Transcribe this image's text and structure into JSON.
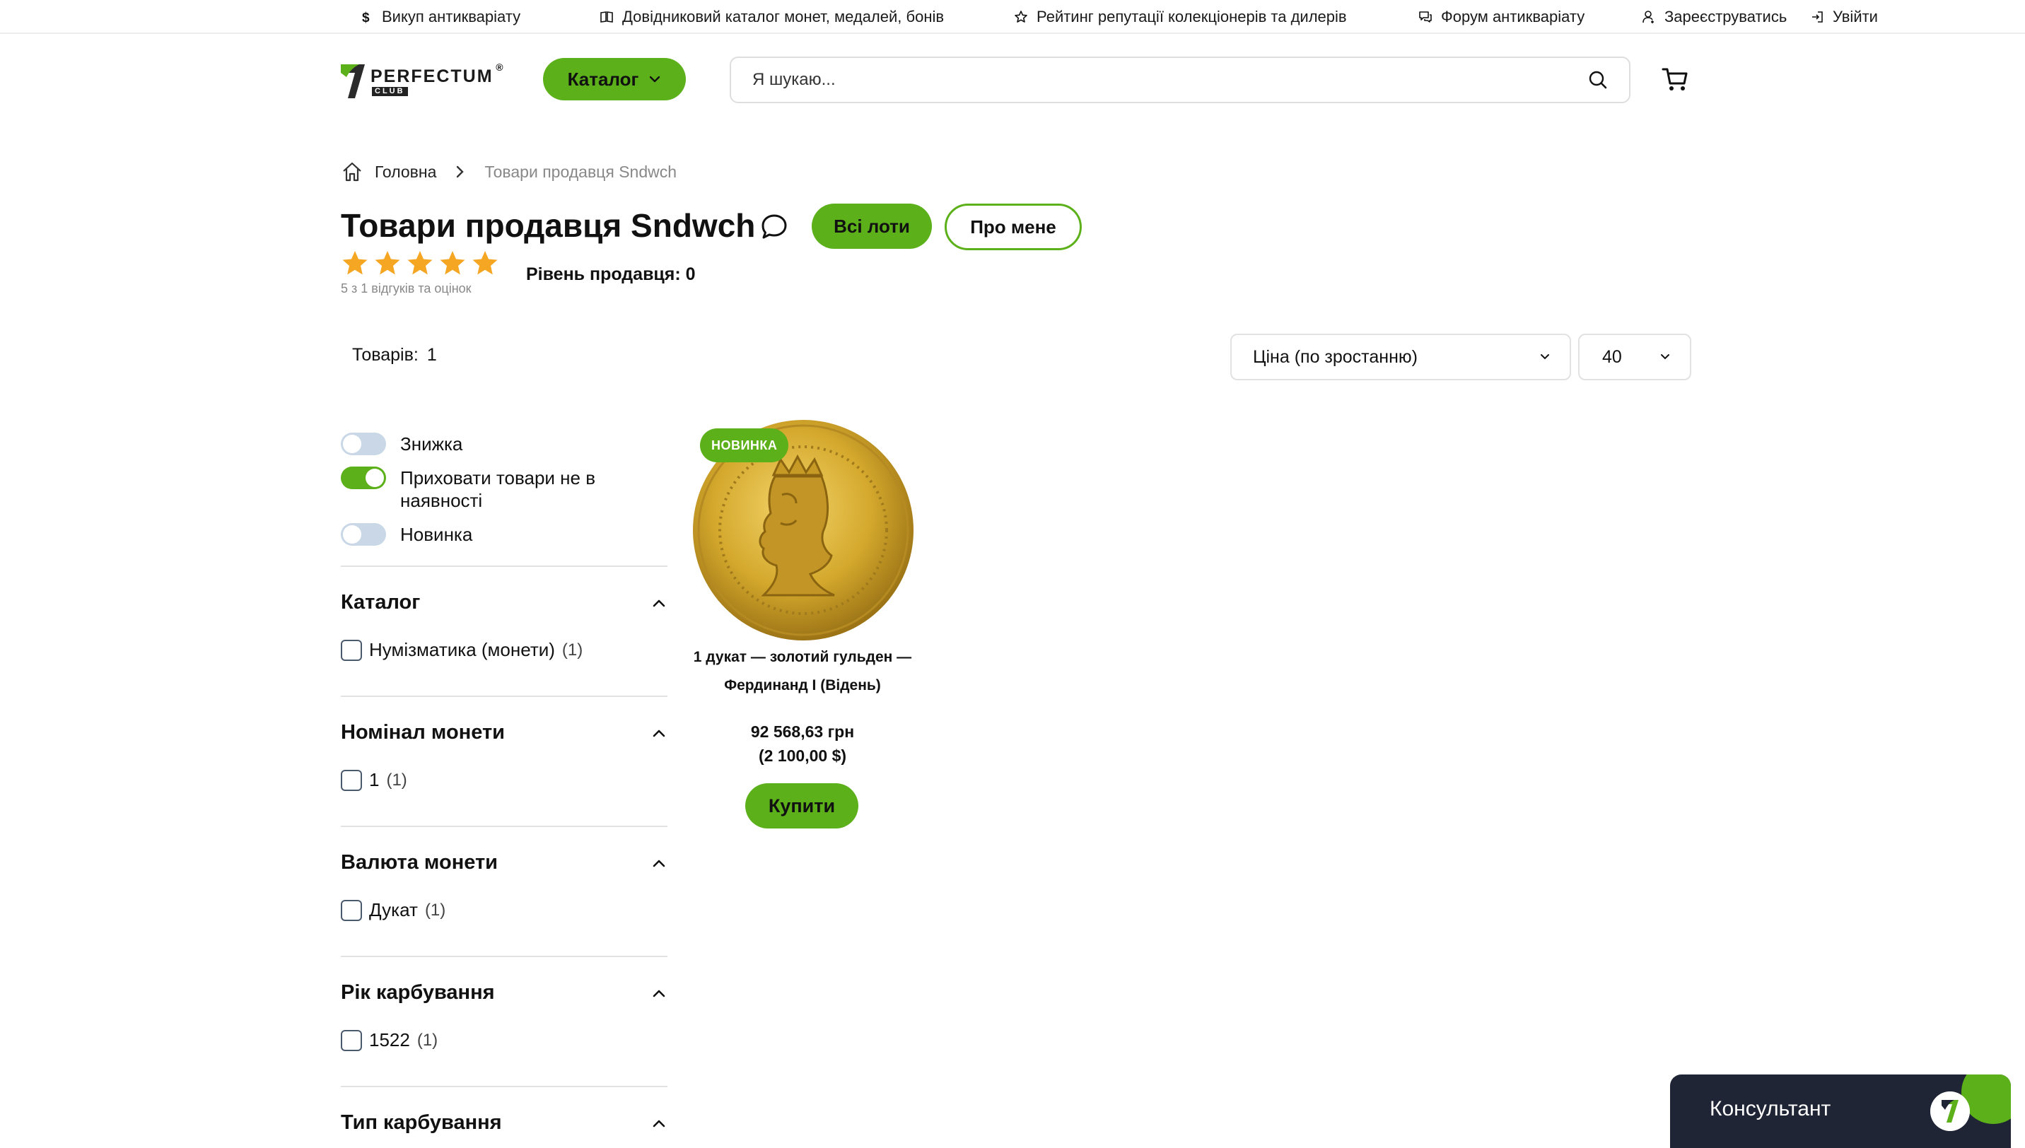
{
  "topbar": {
    "links": [
      {
        "label": "Викуп антикваріату",
        "icon": "dollar-icon"
      },
      {
        "label": "Довідниковий каталог монет, медалей, бонів",
        "icon": "book-icon"
      },
      {
        "label": "Рейтинг репутації колекціонерів та дилерів",
        "icon": "star-outline-icon"
      },
      {
        "label": "Форум антикваріату",
        "icon": "forum-icon"
      },
      {
        "label": "Зареєструватись",
        "icon": "register-icon"
      },
      {
        "label": "Увійти",
        "icon": "login-icon"
      }
    ]
  },
  "header": {
    "logo_name": "PERFECTUM",
    "logo_sub": "CLUB",
    "logo_reg": "®",
    "catalog_label": "Каталог",
    "search_placeholder": "Я шукаю...",
    "cart_icon": "cart-icon"
  },
  "breadcrumb": {
    "home": "Головна",
    "current": "Товари продавця Sndwch"
  },
  "seller": {
    "title": "Товари продавця Sndwch",
    "all_lots_label": "Всі лоти",
    "about_label": "Про мене",
    "rating_stars": 5,
    "rating_text": "5 з 1 відгуків та оцінок",
    "level_text": "Рівень продавця: 0"
  },
  "listing": {
    "count_label": "Товарів:",
    "count_value": "1",
    "sort_value": "Ціна (по зростанню)",
    "per_page_value": "40"
  },
  "filters": {
    "toggles": [
      {
        "label": "Знижка",
        "on": false
      },
      {
        "label": "Приховати товари не в наявності",
        "on": true
      },
      {
        "label": "Новинка",
        "on": false
      }
    ],
    "groups": [
      {
        "title": "Каталог",
        "options": [
          {
            "label": "Нумізматика (монети)",
            "count": "(1)"
          }
        ]
      },
      {
        "title": "Номінал монети",
        "options": [
          {
            "label": "1",
            "count": "(1)"
          }
        ]
      },
      {
        "title": "Валюта монети",
        "options": [
          {
            "label": "Дукат",
            "count": "(1)"
          }
        ]
      },
      {
        "title": "Рік карбування",
        "options": [
          {
            "label": "1522",
            "count": "(1)"
          }
        ]
      },
      {
        "title": "Тип карбування",
        "options": []
      }
    ]
  },
  "products": [
    {
      "badge": "НОВИНКА",
      "name": "1 дукат — золотий гульден — Фердинанд I (Відень)",
      "price_uah": "92 568,63 грн",
      "price_usd": "(2 100,00 $)",
      "buy_label": "Купити"
    }
  ],
  "consultant": {
    "label": "Консультант"
  },
  "colors": {
    "accent": "#5cb01a",
    "dark": "#1f2535",
    "star": "#f5a623"
  }
}
